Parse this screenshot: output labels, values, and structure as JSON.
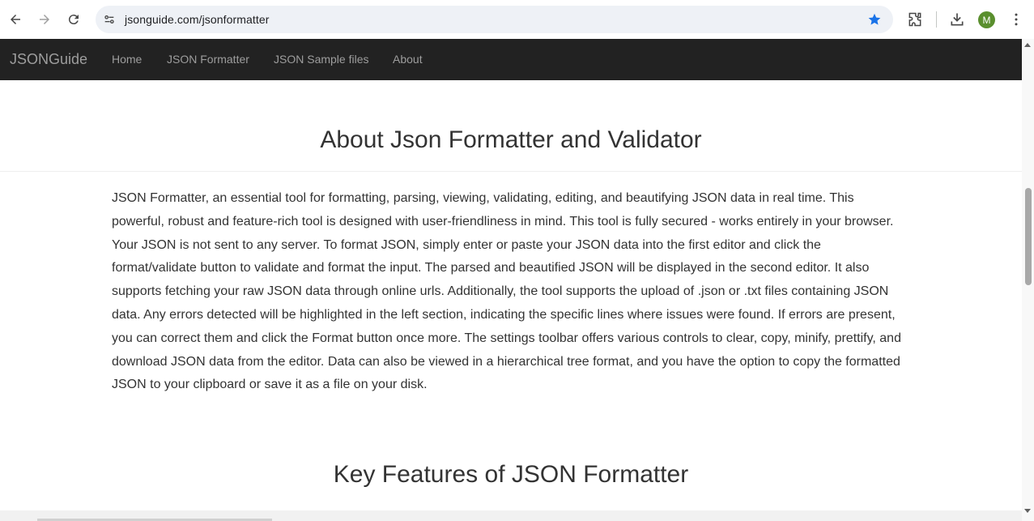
{
  "browser": {
    "url": "jsonguide.com/jsonformatter",
    "avatar_letter": "M",
    "accent_color": "#1a73e8",
    "icons": [
      "back-arrow-icon",
      "forward-arrow-icon",
      "reload-icon",
      "site-info-icon",
      "bookmark-star-icon",
      "extensions-icon",
      "download-icon",
      "menu-kebab-icon"
    ]
  },
  "navbar": {
    "brand": "JSONGuide",
    "links": [
      "Home",
      "JSON Formatter",
      "JSON Sample files",
      "About"
    ],
    "background": "#222222"
  },
  "main": {
    "about_heading": "About Json Formatter and Validator",
    "about_text": "JSON Formatter, an essential tool for formatting, parsing, viewing, validating, editing, and beautifying JSON data in real time. This powerful, robust and feature-rich tool is designed with user-friendliness in mind. This tool is fully secured - works entirely in your browser. Your JSON is not sent to any server. To format JSON, simply enter or paste your JSON data into the first editor and click the format/validate button to validate and format the input. The parsed and beautified JSON will be displayed in the second editor. It also supports fetching your raw JSON data through online urls. Additionally, the tool supports the upload of .json or .txt files containing JSON data. Any errors detected will be highlighted in the left section, indicating the specific lines where issues were found. If errors are present, you can correct them and click the Format button once more. The settings toolbar offers various controls to clear, copy, minify, prettify, and download JSON data from the editor. Data can also be viewed in a hierarchical tree format, and you have the option to copy the formatted JSON to your clipboard or save it as a file on your disk.",
    "features_heading": "Key Features of JSON Formatter"
  }
}
